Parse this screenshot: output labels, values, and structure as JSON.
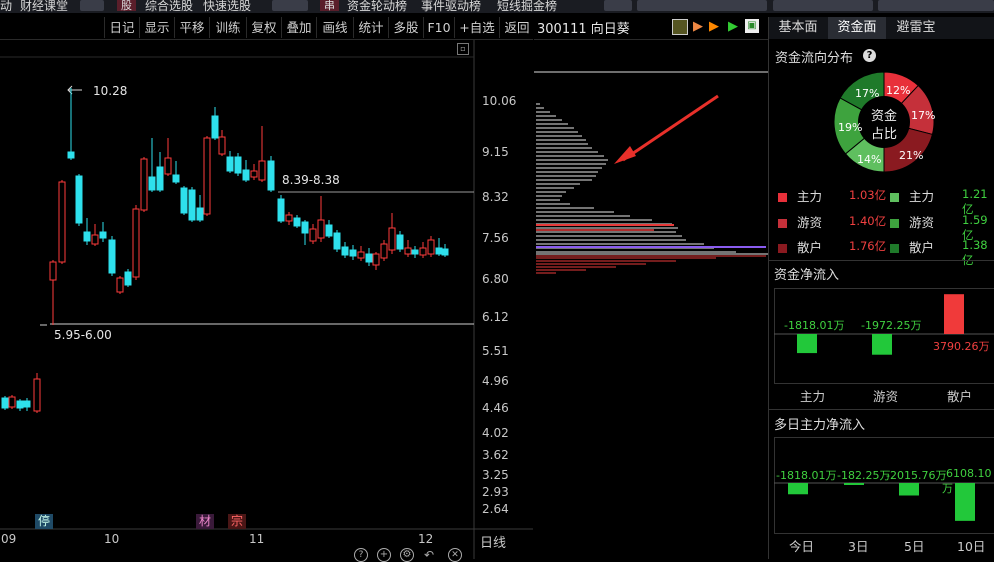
{
  "topbar": {
    "items": [
      "动",
      "财经课堂",
      "股",
      "综合选股",
      "快速选股",
      "串",
      "资金轮动榜",
      "事件驱动榜",
      "短线掘金榜"
    ]
  },
  "toolbar": {
    "buttons": [
      "日记",
      "显示",
      "平移",
      "训练",
      "复权",
      "叠加",
      "画线",
      "统计",
      "多股",
      "F10",
      "+自选",
      "返回"
    ]
  },
  "stock": {
    "code": "300111",
    "name": "向日葵",
    "title": "300111 向日葵"
  },
  "kline": {
    "price_labels": [
      "10.06",
      "9.15",
      "8.32",
      "7.56",
      "6.80",
      "6.12",
      "5.51",
      "4.96",
      "4.46",
      "4.02",
      "3.62",
      "3.25",
      "2.93",
      "2.64"
    ],
    "high_label": "10.28",
    "upper_band_label": "8.39-8.38",
    "lower_band_label": "5.95-6.00",
    "date_labels": [
      "09",
      "10",
      "11",
      "12"
    ],
    "period_label": "日线",
    "markers": {
      "stop": "停",
      "material": "材",
      "zong": "宗"
    }
  },
  "right_panel": {
    "tabs": [
      "基本面",
      "资金面",
      "避雷宝"
    ],
    "flow_title": "资金流向分布",
    "donut_center": [
      "资金",
      "占比"
    ],
    "donut_segments": [
      {
        "label": "12%",
        "value": 12,
        "color": "#e8303a"
      },
      {
        "label": "17%",
        "value": 17,
        "color": "#c5303a"
      },
      {
        "label": "21%",
        "value": 21,
        "color": "#8a1a20"
      },
      {
        "label": "14%",
        "value": 14,
        "color": "#5fbf5f"
      },
      {
        "label": "19%",
        "value": 19,
        "color": "#3ea33e"
      },
      {
        "label": "17%",
        "value": 17,
        "color": "#1f7a2a"
      }
    ],
    "flow_rows": [
      {
        "in_label": "主力",
        "in_value": "1.03亿",
        "in_color": "#e8303a",
        "out_label": "主力",
        "out_value": "1.21亿",
        "out_color": "#5fbf5f"
      },
      {
        "in_label": "游资",
        "in_value": "1.40亿",
        "in_color": "#c5303a",
        "out_label": "游资",
        "out_value": "1.59亿",
        "out_color": "#3ea33e"
      },
      {
        "in_label": "散户",
        "in_value": "1.76亿",
        "in_color": "#8a1a20",
        "out_label": "散户",
        "out_value": "1.38亿",
        "out_color": "#1f7a2a"
      }
    ],
    "net_title": "资金净流入",
    "net_bars": [
      {
        "category": "主力",
        "value_label": "-1818.01万",
        "value": -1818.01
      },
      {
        "category": "游资",
        "value_label": "-1972.25万",
        "value": -1972.25
      },
      {
        "category": "散户",
        "value_label": "3790.26万",
        "value": 3790.26
      }
    ],
    "multi_title": "多日主力净流入",
    "multi_bars": [
      {
        "category": "今日",
        "value_label": "-1818.01万",
        "value": -1818.01
      },
      {
        "category": "3日",
        "value_label": "-182.25万",
        "value": -182.25
      },
      {
        "category": "5日",
        "value_label": "-2015.76万",
        "value": -2015.76
      },
      {
        "category": "10日",
        "value_label": "-6108.10万",
        "value": -6108.1
      }
    ]
  }
}
